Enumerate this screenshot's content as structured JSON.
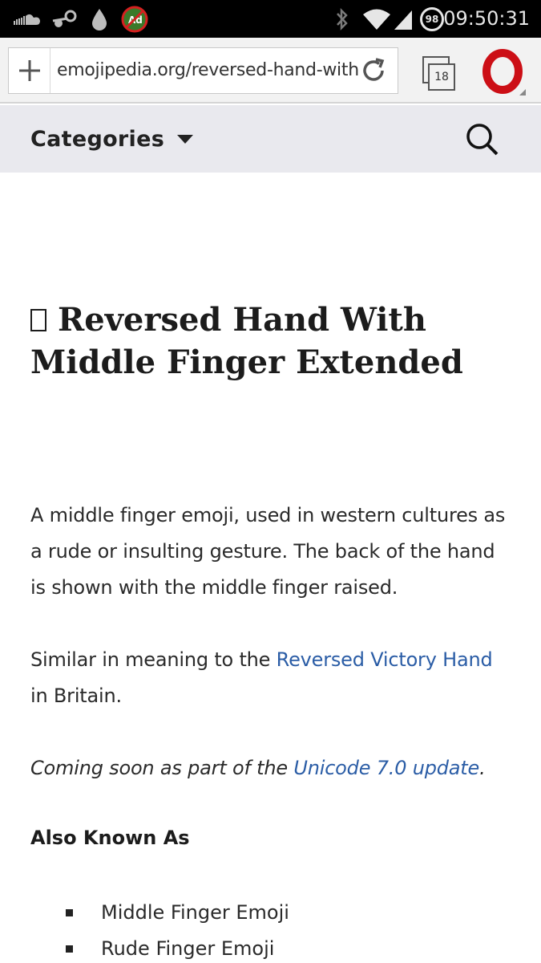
{
  "status_bar": {
    "time": "09:50:31",
    "battery_level": "98",
    "icons": [
      "soundcloud-icon",
      "steam-icon",
      "drop-icon",
      "adblock-icon",
      "bluetooth-icon",
      "wifi-icon",
      "signal-icon"
    ]
  },
  "browser": {
    "url": "emojipedia.org/reversed-hand-with-middle-finger-extended/",
    "tab_count": "18",
    "opera_logo": "O",
    "colors": {
      "opera_red": "#cc0f16",
      "link": "#2b5da6"
    }
  },
  "nav": {
    "categories_label": "Categories"
  },
  "article": {
    "title": "Reversed Hand With Middle Finger Extended",
    "paragraph1": "A middle finger emoji, used in western cultures as a rude or insulting gesture. The back of the hand is shown with the middle finger raised.",
    "paragraph2_prefix": "Similar in meaning to the ",
    "paragraph2_link": "Reversed Victory Hand",
    "paragraph2_suffix": " in Britain.",
    "paragraph3_prefix": "Coming soon as part of the ",
    "paragraph3_link": "Unicode 7.0 update",
    "paragraph3_suffix": ".",
    "aka_heading": "Also Known As",
    "aka_items": [
      "Middle Finger Emoji",
      "Rude Finger Emoji"
    ]
  }
}
